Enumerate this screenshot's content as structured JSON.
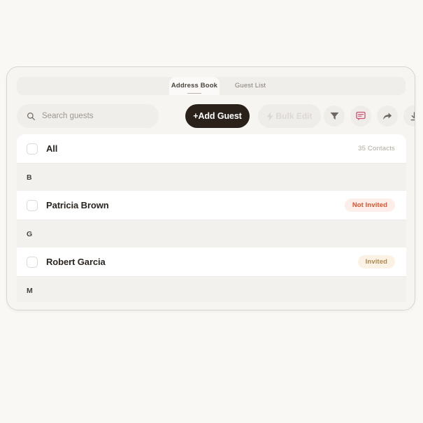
{
  "tabs": [
    {
      "label": "Address Book",
      "active": true
    },
    {
      "label": "Guest List",
      "active": false
    }
  ],
  "toolbar": {
    "search_placeholder": "Search guests",
    "search_value": "",
    "add_guest_label": "+Add Guest",
    "bulk_edit_label": "Bulk Edit",
    "icons": [
      {
        "name": "filter-icon",
        "color": "#6e6761"
      },
      {
        "name": "comment-icon",
        "color": "#cc5070"
      },
      {
        "name": "share-icon",
        "color": "#6e6761"
      },
      {
        "name": "download-icon",
        "color": "#6e6761"
      }
    ]
  },
  "list": {
    "all_row": {
      "label": "All",
      "count": "35 Contacts"
    },
    "sections": [
      {
        "letter": "B",
        "contacts": [
          {
            "name": "Patricia Brown",
            "status": "Not Invited",
            "status_kind": "not-invited"
          }
        ]
      },
      {
        "letter": "G",
        "contacts": [
          {
            "name": "Robert Garcia",
            "status": "Invited",
            "status_kind": "invited"
          }
        ]
      },
      {
        "letter": "M",
        "contacts": []
      }
    ]
  },
  "colors": {
    "page_background": "#faf8f5",
    "card_background": "#f7f5f2",
    "accent_dark": "#2b211b",
    "badge_not_invited_text": "#e4512a",
    "badge_not_invited_bg": "#fdeee9",
    "badge_invited_text": "#b08650",
    "badge_invited_bg": "#faf2e4"
  }
}
